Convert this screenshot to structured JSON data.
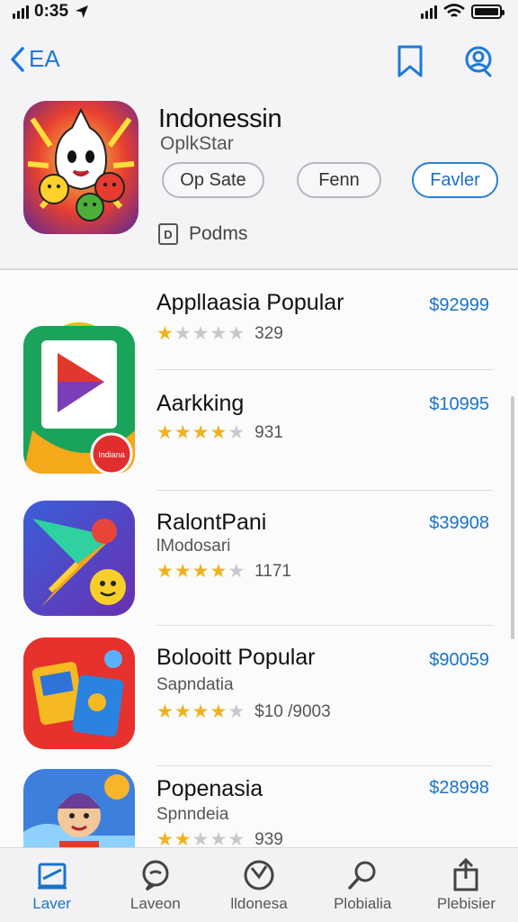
{
  "status_bar": {
    "time": "0:35"
  },
  "nav": {
    "back_label": "EA"
  },
  "header": {
    "title": "Indonessin",
    "developer": "OplkStar",
    "buttons": [
      "Op Sate",
      "Fenn",
      "Favler"
    ],
    "info_label": "Podms",
    "info_icon_letter": "D"
  },
  "apps": [
    {
      "name": "Appllaasia Popular",
      "subtitle": "",
      "stars": 1,
      "rating_count": "329",
      "price": "$92999"
    },
    {
      "name": "Aarkking",
      "subtitle": "",
      "stars": 4,
      "rating_count": "931",
      "price": "$10995"
    },
    {
      "name": "RalontPani",
      "subtitle": "lModosari",
      "stars": 4,
      "rating_count": "1171",
      "price": "$39908"
    },
    {
      "name": "Bolooitt Popular",
      "subtitle": "Sapndatia",
      "stars": 4,
      "rating_count": "$10 /9003",
      "price": "$90059"
    },
    {
      "name": "Popenasia",
      "subtitle": "Spnndeia",
      "stars": 2,
      "rating_count": "939",
      "price": "$28998"
    }
  ],
  "tabs": [
    {
      "label": "Laver",
      "icon": "news-icon",
      "active": true
    },
    {
      "label": "Laveon",
      "icon": "chat-icon",
      "active": false
    },
    {
      "label": "lldonesa",
      "icon": "clock-icon",
      "active": false
    },
    {
      "label": "Plobialia",
      "icon": "search-icon",
      "active": false
    },
    {
      "label": "Plebisier",
      "icon": "share-icon",
      "active": false
    }
  ],
  "colors": {
    "accent": "#1c7ad8",
    "star": "#f2b11b"
  }
}
